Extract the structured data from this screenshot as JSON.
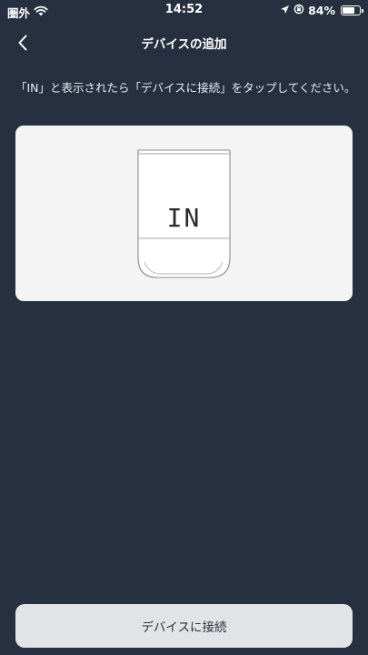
{
  "status_bar": {
    "carrier": "圏外",
    "time": "14:52",
    "battery_percent": "84%",
    "battery_level": 0.84,
    "icons": [
      "wifi-icon",
      "location-arrow-icon",
      "rotation-lock-icon",
      "battery-icon"
    ]
  },
  "nav": {
    "title": "デバイスの追加",
    "back_icon": "chevron-left-icon"
  },
  "instruction": "「IN」と表示されたら「デバイスに接続」をタップしてください。",
  "device": {
    "display_text": "IN"
  },
  "connect_button": {
    "label": "デバイスに接続"
  },
  "colors": {
    "background": "#263040",
    "card": "#f4f4f4",
    "button": "#e1e3e7"
  }
}
